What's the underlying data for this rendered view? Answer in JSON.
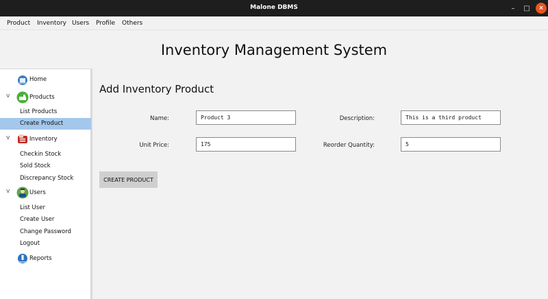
{
  "window": {
    "title": "Malone DBMS",
    "controls": {
      "minimize": "–",
      "maximize": "□",
      "close": "×"
    }
  },
  "menubar": {
    "items": [
      "Product",
      "Inventory",
      "Users",
      "Profile",
      "Others"
    ]
  },
  "header": {
    "title": "Inventory Management System"
  },
  "sidebar": {
    "items": [
      {
        "label": "Home",
        "icon": "home-icon"
      },
      {
        "label": "Products",
        "icon": "products-icon",
        "expanded": true
      },
      {
        "label": "List Products"
      },
      {
        "label": "Create Product",
        "selected": true
      },
      {
        "label": "Inventory",
        "icon": "inventory-icon",
        "expanded": true
      },
      {
        "label": "Checkin Stock"
      },
      {
        "label": "Sold Stock"
      },
      {
        "label": "Discrepancy Stock"
      },
      {
        "label": "Users",
        "icon": "users-icon",
        "expanded": true
      },
      {
        "label": "List User"
      },
      {
        "label": "Create User"
      },
      {
        "label": "Change Password"
      },
      {
        "label": "Logout"
      },
      {
        "label": "Reports",
        "icon": "reports-icon"
      }
    ],
    "chevron": "v"
  },
  "form": {
    "title": "Add Inventory Product",
    "name_label": "Name:",
    "name_value": "Product 3",
    "description_label": "Description:",
    "description_value": "This is a third product",
    "unit_price_label": "Unit Price:",
    "unit_price_value": "175",
    "reorder_label": "Reorder Quantity:",
    "reorder_value": "5",
    "submit_label": "CREATE PRODUCT"
  },
  "colors": {
    "titlebar": "#1e1e1e",
    "close_button": "#e95420",
    "selection": "#a3c8ec",
    "button": "#cfcfcf"
  }
}
